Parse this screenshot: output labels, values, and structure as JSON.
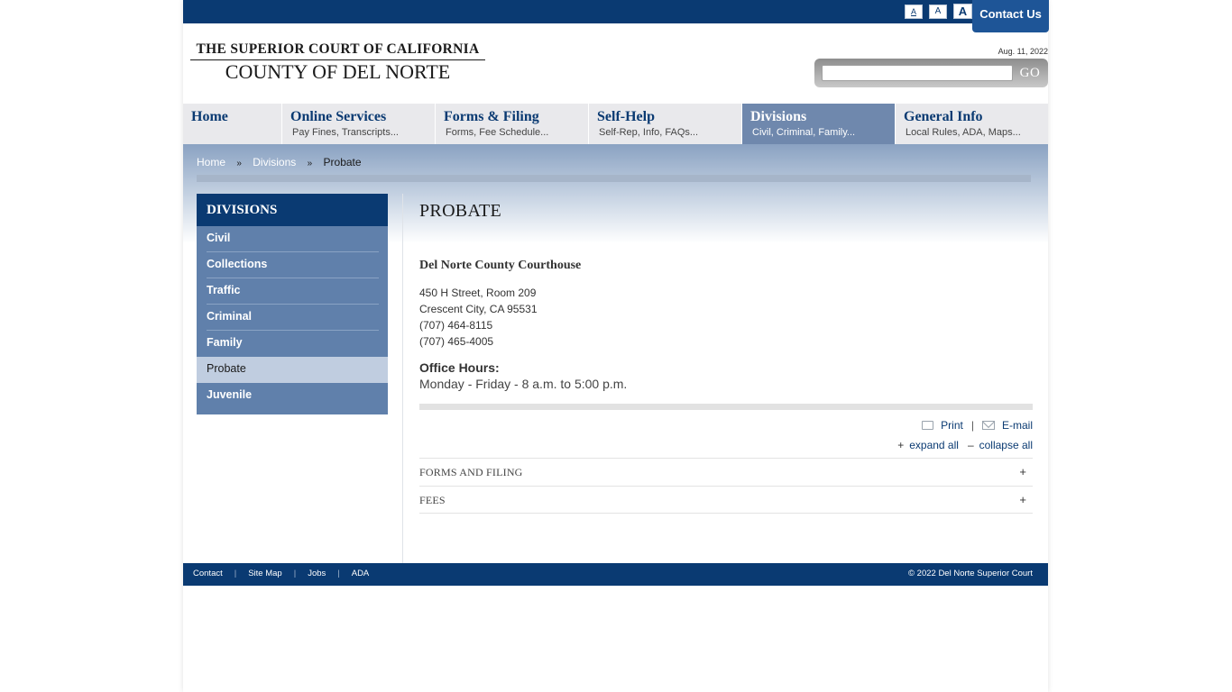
{
  "header": {
    "font_sizes": [
      "A",
      "A",
      "A"
    ],
    "contact_label": "Contact Us",
    "logo_line1": "THE SUPERIOR COURT OF CALIFORNIA",
    "logo_line2": "COUNTY OF DEL NORTE",
    "date": "Aug. 11, 2022",
    "search_placeholder": "",
    "search_go": "GO"
  },
  "nav": [
    {
      "title": "Home",
      "sub": ""
    },
    {
      "title": "Online Services",
      "sub": "Pay Fines, Transcripts..."
    },
    {
      "title": "Forms & Filing",
      "sub": "Forms, Fee Schedule..."
    },
    {
      "title": "Self-Help",
      "sub": "Self-Rep, Info, FAQs..."
    },
    {
      "title": "Divisions",
      "sub": "Civil, Criminal, Family..."
    },
    {
      "title": "General Info",
      "sub": "Local Rules, ADA, Maps..."
    }
  ],
  "breadcrumb": {
    "items": [
      "Home",
      "Divisions"
    ],
    "separator": "»",
    "current": "Probate"
  },
  "sidebar": {
    "heading": "DIVISIONS",
    "items": [
      "Civil",
      "Collections",
      "Traffic",
      "Criminal",
      "Family",
      "Probate",
      "Juvenile"
    ],
    "active": "Probate"
  },
  "main": {
    "title": "PROBATE",
    "location_name": "Del Norte County Courthouse",
    "address_lines": [
      "450 H Street, Room 209",
      "Crescent City, CA 95531",
      "(707) 464-8115",
      "(707) 465-4005"
    ],
    "hours_label": "Office Hours:",
    "hours_value": "Monday - Friday - 8 a.m. to 5:00 p.m.",
    "tools": {
      "print": "Print",
      "separator": "|",
      "email": "E-mail"
    },
    "expand_all": "expand all",
    "collapse_all": "collapse all",
    "expand_symbol": "+",
    "collapse_symbol": "–",
    "accordion": [
      {
        "title": "FORMS AND FILING",
        "toggle": "+"
      },
      {
        "title": "FEES",
        "toggle": "+"
      }
    ]
  },
  "footer": {
    "links": [
      "Contact",
      "Site Map",
      "Jobs",
      "ADA"
    ],
    "separator": "|",
    "copyright": "© 2022 Del Norte Superior Court"
  },
  "colors": {
    "primary": "#0a3a72",
    "nav_active": "#6f88ad",
    "sidebar": "#6080ab",
    "sidebar_active": "#c0cde0"
  }
}
